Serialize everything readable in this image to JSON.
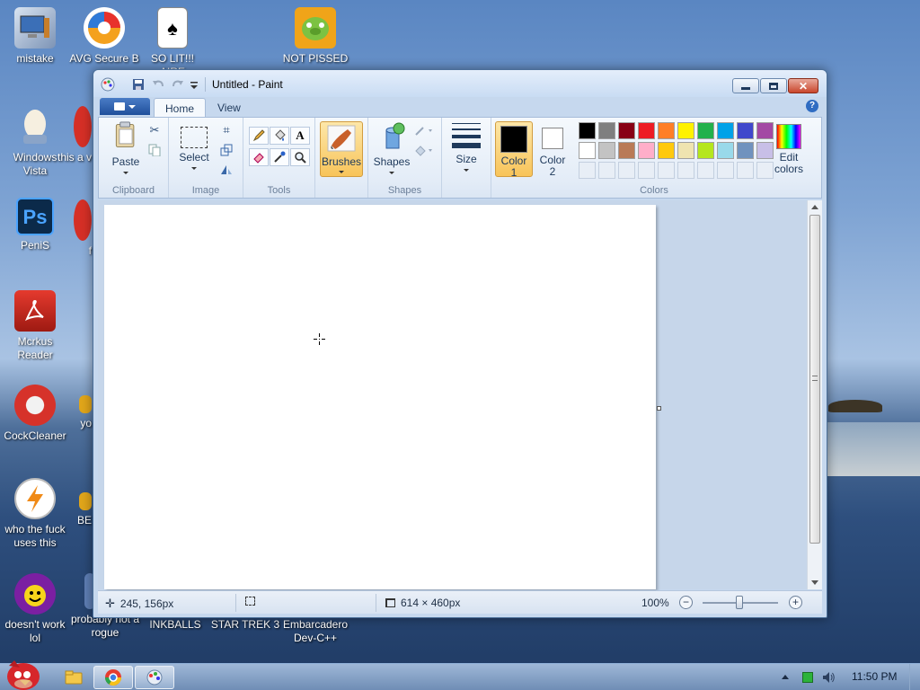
{
  "desktop": {
    "icons": [
      {
        "label": "mistake"
      },
      {
        "label": "AVG Secure B"
      },
      {
        "label": "SO LIT!!! AIRE"
      },
      {
        "label": "NOT PISSED"
      },
      {
        "label": "Windows Vista"
      },
      {
        "label": "this a v"
      },
      {
        "label": "PeniS"
      },
      {
        "label": "f"
      },
      {
        "label": "Mcrkus Reader"
      },
      {
        "label": "CockCleaner"
      },
      {
        "label": "yo"
      },
      {
        "label": "who the fuck uses this"
      },
      {
        "label": "BE"
      },
      {
        "label": "doesn't work lol"
      },
      {
        "label": "probably not a rogue"
      },
      {
        "label": "INKBALLS"
      },
      {
        "label": "STAR TREK 3"
      },
      {
        "label": "Embarcadero Dev-C++"
      }
    ],
    "photoshop_glyph": "Ps"
  },
  "window": {
    "title": "Untitled - Paint",
    "tabs": {
      "home": "Home",
      "view": "View"
    },
    "help_glyph": "?",
    "close_glyph": "✕"
  },
  "ribbon": {
    "clipboard": {
      "paste": "Paste",
      "group": "Clipboard"
    },
    "image": {
      "select": "Select",
      "group": "Image"
    },
    "tools": {
      "group": "Tools",
      "text_glyph": "A"
    },
    "brushes": {
      "label": "Brushes"
    },
    "shapes": {
      "label": "Shapes",
      "group": "Shapes"
    },
    "size": {
      "label": "Size"
    },
    "colors": {
      "color1_line1": "Color",
      "color1_line2": "1",
      "color2_line1": "Color",
      "color2_line2": "2",
      "edit_line1": "Edit",
      "edit_line2": "colors",
      "group": "Colors",
      "color1": "#000000",
      "color2": "#ffffff",
      "palette_row1": [
        "#000000",
        "#7f7f7f",
        "#880015",
        "#ed1c24",
        "#ff7f27",
        "#fff200",
        "#22b14c",
        "#00a2e8",
        "#3f48cc",
        "#a349a4"
      ],
      "palette_row2": [
        "#ffffff",
        "#c3c3c3",
        "#b97a57",
        "#ffaec9",
        "#ffc90e",
        "#efe4b0",
        "#b5e61d",
        "#99d9ea",
        "#7092be",
        "#c8bfe7"
      ]
    }
  },
  "status": {
    "cursor_pos": "245, 156px",
    "canvas_size": "614 × 460px",
    "zoom": "100%",
    "zoom_out_glyph": "−",
    "zoom_in_glyph": "+"
  },
  "taskbar": {
    "clock": "11:50 PM"
  }
}
